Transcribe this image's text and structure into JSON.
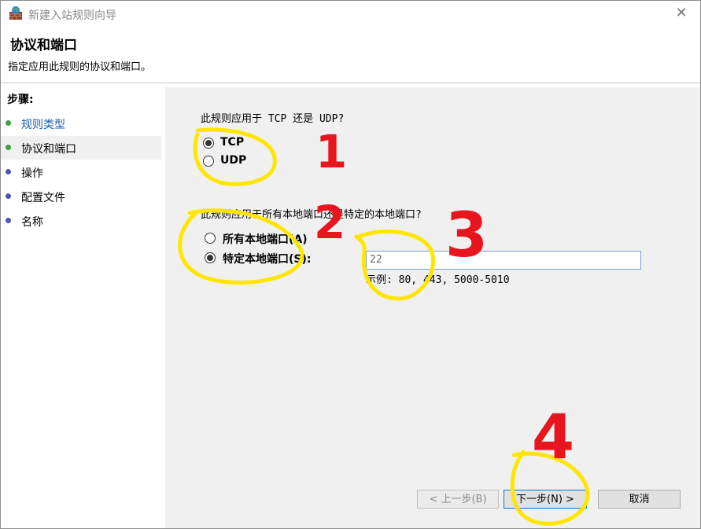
{
  "window": {
    "title": "新建入站规则向导"
  },
  "header": {
    "title": "协议和端口",
    "subtitle": "指定应用此规则的协议和端口。"
  },
  "sidebar": {
    "heading": "步骤:",
    "items": [
      {
        "label": "规则类型",
        "dot_color": "#3fa13f",
        "text_color": "#1f5fa8",
        "active": false
      },
      {
        "label": "协议和端口",
        "dot_color": "#3fa13f",
        "text_color": "#000000",
        "active": true
      },
      {
        "label": "操作",
        "dot_color": "#4a57b8",
        "text_color": "#000000",
        "active": false
      },
      {
        "label": "配置文件",
        "dot_color": "#4a57b8",
        "text_color": "#000000",
        "active": false
      },
      {
        "label": "名称",
        "dot_color": "#4a57b8",
        "text_color": "#000000",
        "active": false
      }
    ]
  },
  "protocol": {
    "question": "此规则应用于 TCP 还是 UDP?",
    "tcp_label": "TCP",
    "udp_label": "UDP",
    "selected": "TCP"
  },
  "ports": {
    "question": "此规则应用于所有本地端口还是特定的本地端口?",
    "all_label": "所有本地端口(A)",
    "specific_label": "特定本地端口(S):",
    "selected": "specific",
    "value": "22",
    "example": "示例: 80, 443, 5000-5010"
  },
  "buttons": {
    "back": "< 上一步(B)",
    "next": "下一步(N) >",
    "cancel": "取消"
  },
  "annotations": {
    "marks": [
      "1",
      "2",
      "3",
      "4"
    ],
    "circle_color": "#ffe600",
    "number_color": "#e8141e"
  }
}
